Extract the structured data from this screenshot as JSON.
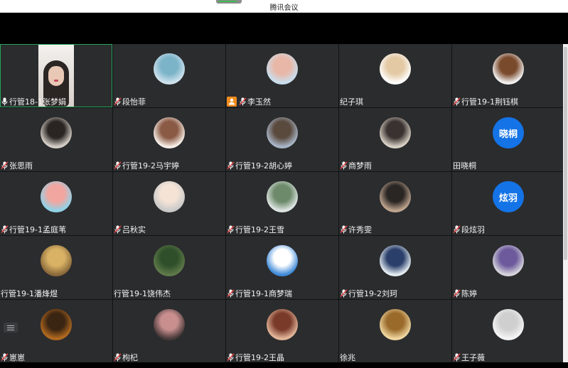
{
  "window": {
    "title": "腾讯会议"
  },
  "colors": {
    "accent_blue": "#1473e6",
    "active_border": "#25a35a",
    "tile_bg": "#2b2c2e"
  },
  "participants": [
    {
      "name": "行管18-1张梦娟",
      "mic": "on",
      "video": true,
      "active": true
    },
    {
      "name": "段怡菲",
      "mic": "muted",
      "avatar": [
        "#cfe3ee",
        "#7bb3c8"
      ]
    },
    {
      "name": "李玉然",
      "mic": "muted",
      "share": true,
      "avatar": [
        "#c9dfef",
        "#e8b7a8"
      ]
    },
    {
      "name": "纪子琪",
      "mic": "none",
      "avatar": [
        "#ffffff",
        "#e3c9a4"
      ]
    },
    {
      "name": "行管19-1荆钰棋",
      "mic": "muted",
      "avatar": [
        "#f2f2f2",
        "#7a4a2c"
      ]
    },
    {
      "name": "张思雨",
      "mic": "muted",
      "avatar": [
        "#d6d0c8",
        "#2a2523"
      ]
    },
    {
      "name": "行管19-2马宇婷",
      "mic": "muted",
      "avatar": [
        "#f7efe8",
        "#8a5a45"
      ]
    },
    {
      "name": "行管19-2胡心婷",
      "mic": "muted",
      "avatar": [
        "#a9b6c8",
        "#5a4a3e"
      ]
    },
    {
      "name": "商梦雨",
      "mic": "muted",
      "avatar": [
        "#d9d2c6",
        "#3a3230"
      ]
    },
    {
      "name": "田晓桐",
      "mic": "none",
      "initials": "晓桐"
    },
    {
      "name": "行管19-1孟庭苇",
      "mic": "muted",
      "avatar": [
        "#8fd3e8",
        "#f2a6a0"
      ]
    },
    {
      "name": "吕秋实",
      "mic": "muted",
      "avatar": [
        "#c9c9c9",
        "#f5e4d6"
      ]
    },
    {
      "name": "行管19-2王雪",
      "mic": "muted",
      "avatar": [
        "#dfe6e4",
        "#6d8a6a"
      ]
    },
    {
      "name": "许秀雯",
      "mic": "muted",
      "avatar": [
        "#bfa58f",
        "#2a2624"
      ]
    },
    {
      "name": "段炫羽",
      "mic": "muted",
      "initials": "炫羽"
    },
    {
      "name": "行管19-1潘烽煜",
      "mic": "none",
      "avatar": [
        "#8a6a3a",
        "#d9b266"
      ]
    },
    {
      "name": "行管19-1饶伟杰",
      "mic": "none",
      "avatar": [
        "#5f7a4a",
        "#2f4f2a"
      ]
    },
    {
      "name": "行管19-1商梦瑞",
      "mic": "muted",
      "avatar": [
        "#3f8ad8",
        "#ffffff"
      ]
    },
    {
      "name": "行管19-2刘珂",
      "mic": "muted",
      "avatar": [
        "#e6eef2",
        "#2b3f6b"
      ]
    },
    {
      "name": "陈婷",
      "mic": "muted",
      "avatar": [
        "#d7d5dc",
        "#6c5a9c"
      ]
    },
    {
      "name": "崽崽",
      "mic": "muted",
      "menu": true,
      "avatar": [
        "#b36a1f",
        "#3a2412"
      ]
    },
    {
      "name": "枸杞",
      "mic": "muted",
      "avatar": [
        "#4a3a3a",
        "#c98f8f"
      ]
    },
    {
      "name": "行管19-2王晶",
      "mic": "muted",
      "avatar": [
        "#e3b79a",
        "#7a3a2a"
      ]
    },
    {
      "name": "徐兆",
      "mic": "none",
      "avatar": [
        "#f0d7a0",
        "#9a6a2a"
      ]
    },
    {
      "name": "王子薇",
      "mic": "muted",
      "avatar": [
        "#f4f4f4",
        "#cfcfcf"
      ]
    }
  ]
}
